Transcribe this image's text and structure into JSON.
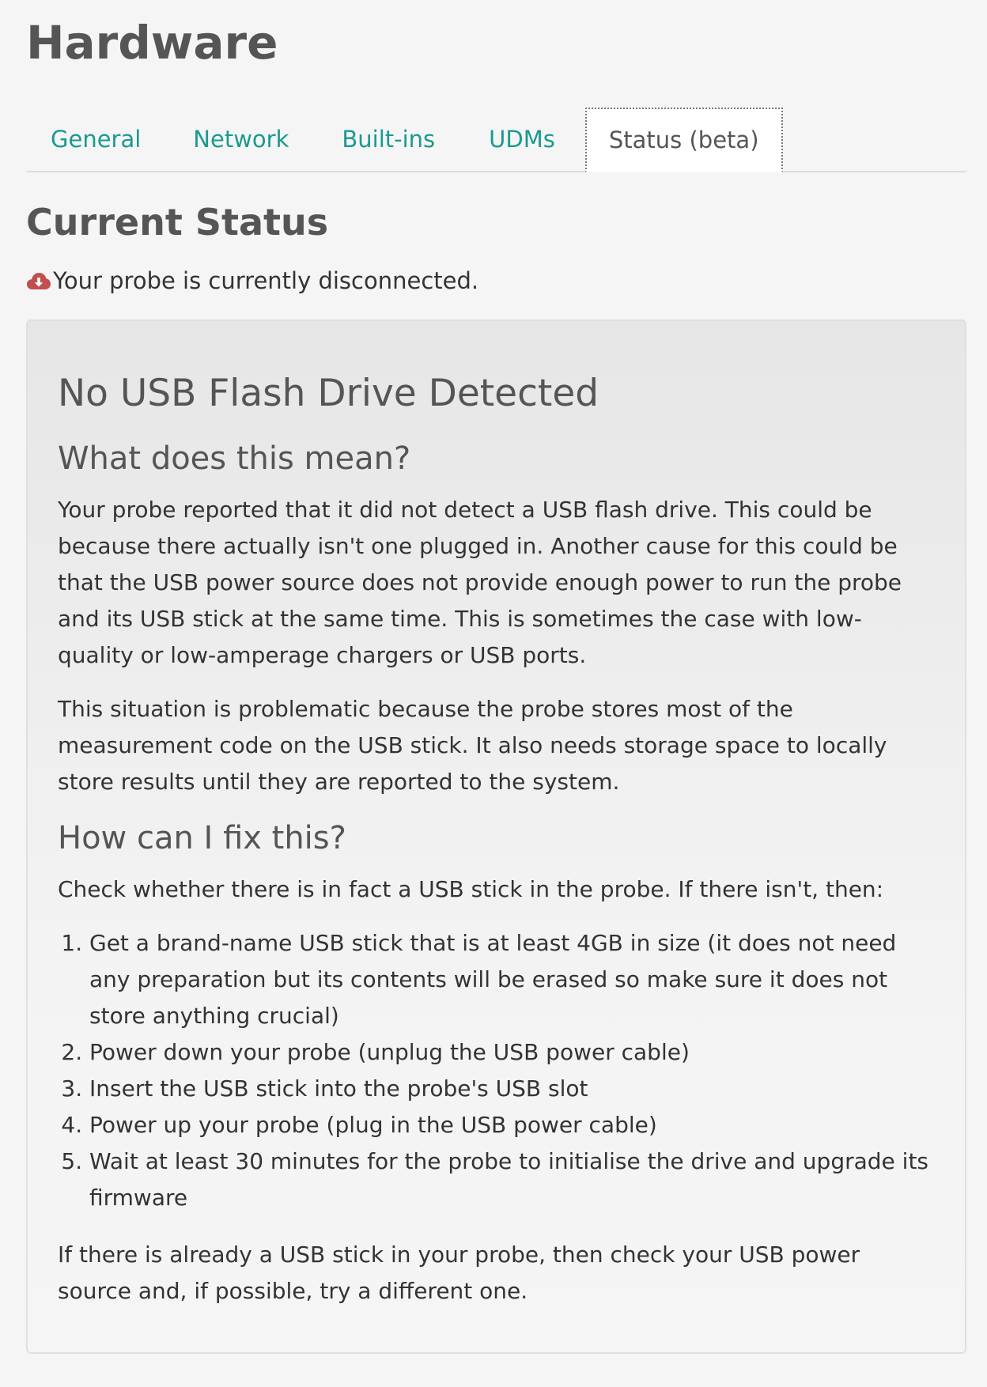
{
  "page": {
    "title": "Hardware"
  },
  "tabs": [
    {
      "label": "General",
      "active": false
    },
    {
      "label": "Network",
      "active": false
    },
    {
      "label": "Built-ins",
      "active": false
    },
    {
      "label": "UDMs",
      "active": false
    },
    {
      "label": "Status (beta)",
      "active": true
    }
  ],
  "status": {
    "heading": "Current Status",
    "icon": "cloud-download-icon",
    "icon_color": "#c0504d",
    "message": "Your probe is currently disconnected."
  },
  "panel": {
    "title": "No USB Flash Drive Detected",
    "meaning_heading": "What does this mean?",
    "meaning_paragraphs": [
      "Your probe reported that it did not detect a USB flash drive. This could be because there actually isn't one plugged in. Another cause for this could be that the USB power source does not provide enough power to run the probe and its USB stick at the same time. This is sometimes the case with low-quality or low-amperage chargers or USB ports.",
      "This situation is problematic because the probe stores most of the measurement code on the USB stick. It also needs storage space to locally store results until they are reported to the system."
    ],
    "fix_heading": "How can I fix this?",
    "fix_intro": "Check whether there is in fact a USB stick in the probe. If there isn't, then:",
    "fix_steps": [
      "Get a brand-name USB stick that is at least 4GB in size (it does not need any preparation but its contents will be erased so make sure it does not store anything crucial)",
      "Power down your probe (unplug the USB power cable)",
      "Insert the USB stick into the probe's USB slot",
      "Power up your probe (plug in the USB power cable)",
      "Wait at least 30 minutes for the probe to initialise the drive and upgrade its firmware"
    ],
    "fix_outro": "If there is already a USB stick in your probe, then check your USB power source and, if possible, try a different one."
  },
  "colors": {
    "tab_link": "#1a9a8f",
    "heading": "#555555",
    "background": "#f5f5f5"
  }
}
